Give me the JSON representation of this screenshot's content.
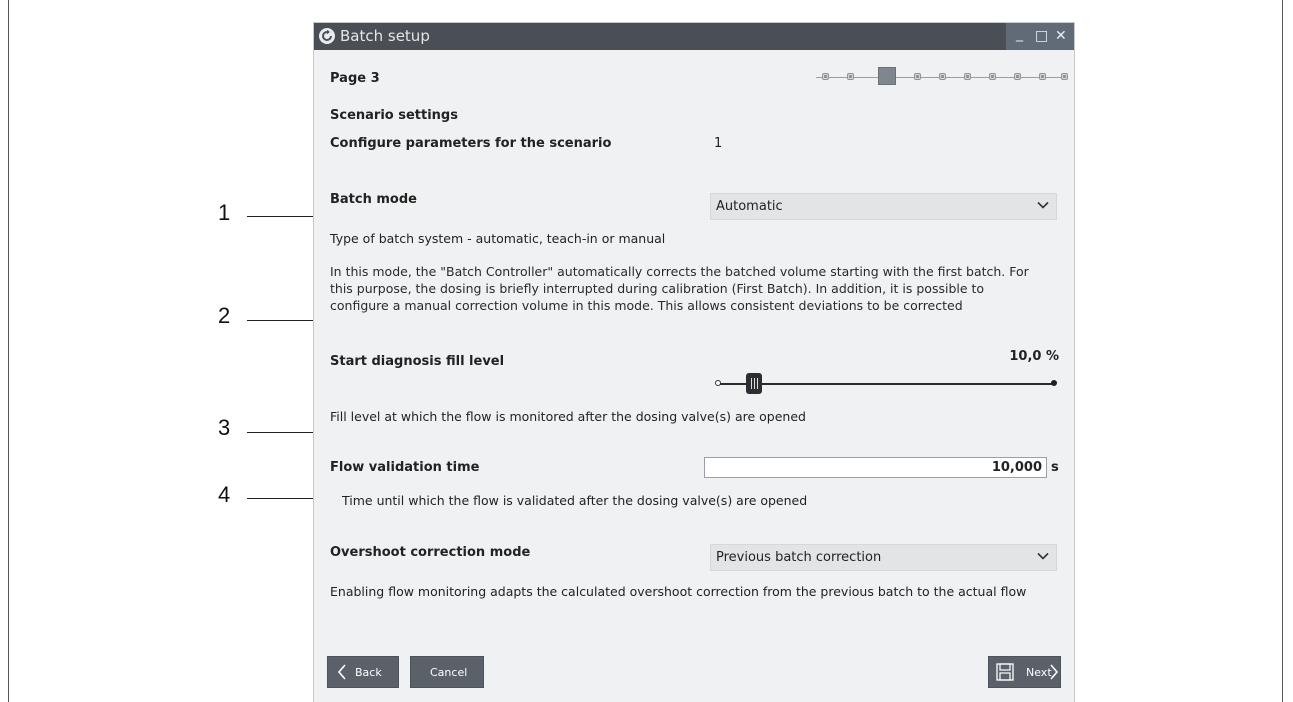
{
  "window": {
    "title": "Batch setup",
    "minimize_glyph": "_",
    "maximize_glyph": "□",
    "close_glyph": "✕",
    "app_icon": "refresh-circle-icon"
  },
  "page": {
    "label": "Page 3",
    "stepper": {
      "total_steps": 10,
      "current_step": 3
    }
  },
  "scenario": {
    "title": "Scenario settings",
    "configure_label": "Configure parameters for the scenario",
    "configure_value": "1"
  },
  "batch_mode": {
    "label": "Batch mode",
    "selected": "Automatic",
    "help": "Type of batch system - automatic, teach-in or manual",
    "description_lines": [
      "In this mode, the \"Batch Controller\" automatically corrects the batched volume starting with the first batch. For",
      "this purpose, the dosing is briefly interrupted during calibration (First Batch). In addition, it is possible to",
      "configure a manual correction volume in this mode. This allows consistent deviations to be corrected"
    ]
  },
  "start_diagnosis": {
    "label": "Start diagnosis fill level",
    "value_text": "10,0  %",
    "value_percent": 10.0,
    "help": "Fill level at which the flow is monitored after the dosing valve(s) are opened"
  },
  "flow_validation": {
    "label": "Flow validation time",
    "value": "10,000",
    "unit": "s",
    "help": "Time until which the flow is validated after the dosing valve(s) are opened"
  },
  "overshoot": {
    "label": "Overshoot correction mode",
    "selected": "Previous batch correction",
    "help": "Enabling flow monitoring adapts the calculated overshoot correction from the previous batch to the actual flow"
  },
  "buttons": {
    "back": "Back",
    "cancel": "Cancel",
    "next": "Next"
  },
  "callouts": [
    "1",
    "2",
    "3",
    "4"
  ]
}
